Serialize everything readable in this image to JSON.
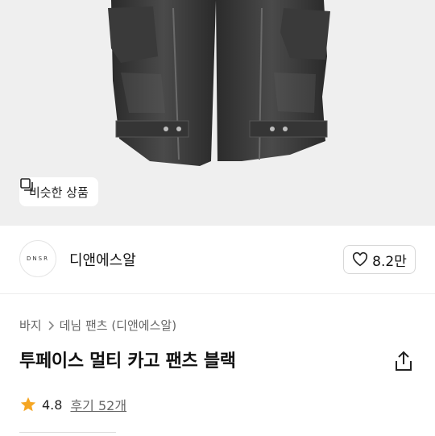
{
  "hero": {
    "similar_label": "비슷한 상품"
  },
  "brand": {
    "logo_text": "DNSR",
    "name": "디앤에스알",
    "like_count": "8.2만"
  },
  "breadcrumb": {
    "items": [
      "바지",
      "데님 팬츠 (디앤에스알)"
    ]
  },
  "product": {
    "title": "투페이스 멀티 카고 팬츠 블랙",
    "rating": "4.8",
    "reviews": "후기 52개"
  },
  "colors": {
    "accent_star": "#f5a623",
    "hero_bg": "#efefef"
  },
  "icons": [
    "copy-icon",
    "heart-icon",
    "chevron-right-icon",
    "share-icon",
    "star-icon"
  ]
}
